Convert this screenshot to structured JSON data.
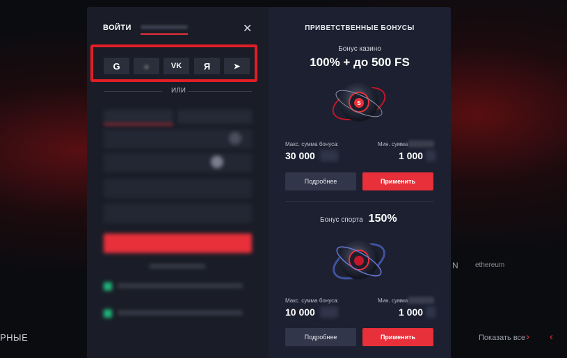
{
  "background": {
    "bottom_left_text": "РНЫЕ",
    "show_all": "Показать все",
    "arrow_right": "›",
    "arrow_left": "‹",
    "logo_text": "N",
    "eth_text": "ethereum"
  },
  "login": {
    "tab_login": "ВОЙТИ",
    "close": "✕",
    "or": "ИЛИ",
    "social": [
      {
        "label": "G",
        "icon": "google-icon"
      },
      {
        "label": "●",
        "icon": "blurred-icon"
      },
      {
        "label": "VK",
        "icon": "vk-icon"
      },
      {
        "label": "Я",
        "icon": "yandex-icon"
      },
      {
        "label": "➤",
        "icon": "telegram-icon"
      }
    ]
  },
  "bonuses": {
    "title": "ПРИВЕТСТВЕННЫЕ БОНУСЫ",
    "casino": {
      "subtitle": "Бонус казино",
      "headline": "100% + до 500 FS",
      "max_label": "Макс. сумма бонуса:",
      "max_value": "30 000",
      "min_label": "Мин. сумма",
      "min_value": "1 000",
      "more": "Подробнее",
      "apply": "Применить"
    },
    "sport": {
      "subtitle": "Бонус спорта",
      "headline": "150%",
      "max_label": "Макс. сумма бонуса:",
      "max_value": "10 000",
      "min_label": "Мин. сумма",
      "min_value": "1 000",
      "more": "Подробнее",
      "apply": "Применить"
    }
  },
  "colors": {
    "accent": "#e8303a",
    "panel": "#1a1d27",
    "panel_right": "#1c2030"
  }
}
